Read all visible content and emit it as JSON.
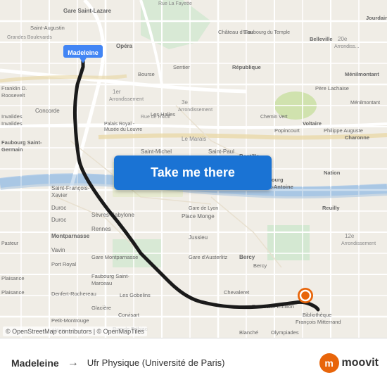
{
  "map": {
    "attribution": "© OpenStreetMap contributors | © OpenMapTiles",
    "background_color": "#f0ede6"
  },
  "button": {
    "label": "Take me there"
  },
  "bottom_bar": {
    "origin": "Madeleine",
    "destination": "Ufr Physique (Université de Paris)",
    "arrow": "→"
  },
  "branding": {
    "name": "moovit",
    "logo_letter": "m"
  },
  "route": {
    "color": "#1a1a1a",
    "dest_pin_color": "#e8650a"
  }
}
